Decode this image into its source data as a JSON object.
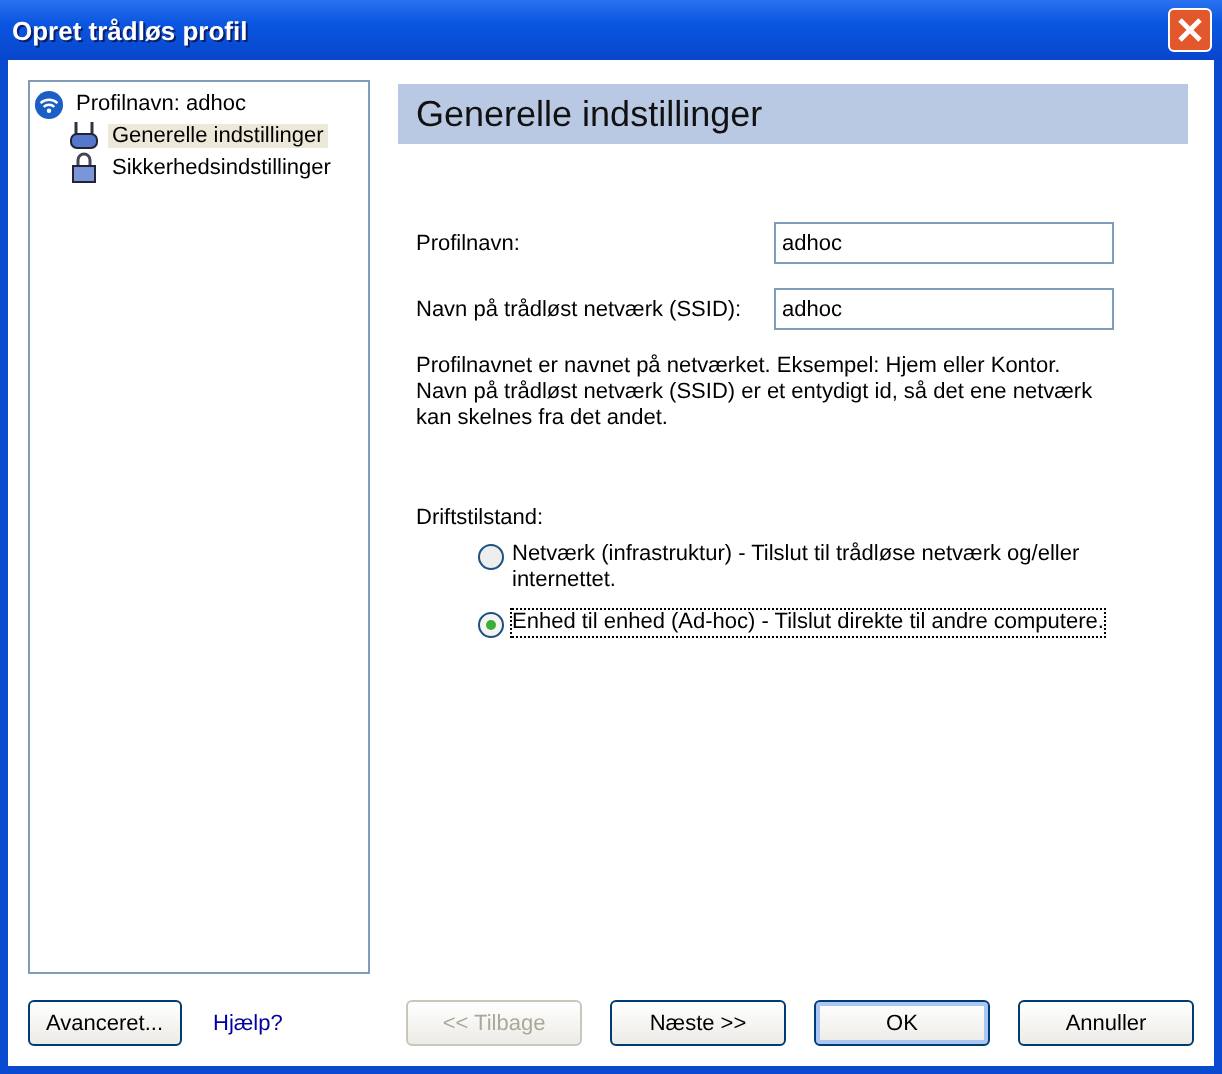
{
  "window": {
    "title": "Opret trådløs profil"
  },
  "tree": {
    "label": "Profilnavn: adhoc",
    "children": [
      {
        "label": "Generelle indstillinger",
        "selected": true,
        "kind": "network"
      },
      {
        "label": "Sikkerhedsindstillinger",
        "selected": false,
        "kind": "lock"
      }
    ]
  },
  "header": "Generelle indstillinger",
  "fields": [
    {
      "label": "Profilnavn:",
      "value": "adhoc"
    },
    {
      "label": "Navn på trådløst netværk (SSID):",
      "value": "adhoc"
    }
  ],
  "description": "Profilnavnet er navnet på netværket. Eksempel: Hjem eller Kontor. Navn på trådløst netværk (SSID) er et entydigt id, så det ene netværk kan skelnes fra det andet.",
  "mode": {
    "label": "Driftstilstand:",
    "options": [
      {
        "label": "Netværk (infrastruktur) - Tilslut til trådløse netværk og/eller internettet.",
        "selected": false
      },
      {
        "label": "Enhed til enhed (Ad-hoc) - Tilslut direkte til andre computere.",
        "selected": true
      }
    ]
  },
  "advanced_button": "Avanceret...",
  "help_link": "Hjælp?",
  "buttons": [
    {
      "label": "<< Tilbage",
      "disabled": true,
      "default": false
    },
    {
      "label": "Næste >>",
      "disabled": false,
      "default": false
    },
    {
      "label": "OK",
      "disabled": false,
      "default": true
    },
    {
      "label": "Annuller",
      "disabled": false,
      "default": false
    }
  ]
}
